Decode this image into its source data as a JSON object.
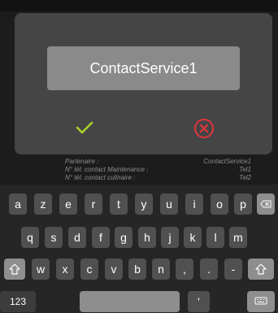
{
  "dialog": {
    "input_value": "ContactService1",
    "confirm_icon": "check-icon",
    "cancel_icon": "close-circle-icon",
    "colors": {
      "confirm": "#a8d22c",
      "cancel": "#e0353b"
    }
  },
  "background_form": [
    {
      "label": "Partenaire :",
      "value": "ContactService1"
    },
    {
      "label": "N° tél. contact Maintenance :",
      "value": "Tel1"
    },
    {
      "label": "N° tél. contact culinaire :",
      "value": "Tel2"
    }
  ],
  "keyboard": {
    "row1": [
      "a",
      "z",
      "e",
      "r",
      "t",
      "y",
      "u",
      "i",
      "o",
      "p"
    ],
    "row2": [
      "q",
      "s",
      "d",
      "f",
      "g",
      "h",
      "j",
      "k",
      "l",
      "m"
    ],
    "row3": [
      "w",
      "x",
      "c",
      "v",
      "b",
      "n",
      ",",
      ".",
      "-"
    ],
    "numbers_label": "123",
    "apostrophe": "'",
    "icons": {
      "backspace": "backspace-icon",
      "shift": "shift-icon",
      "hide_keyboard": "keyboard-hide-icon"
    }
  }
}
